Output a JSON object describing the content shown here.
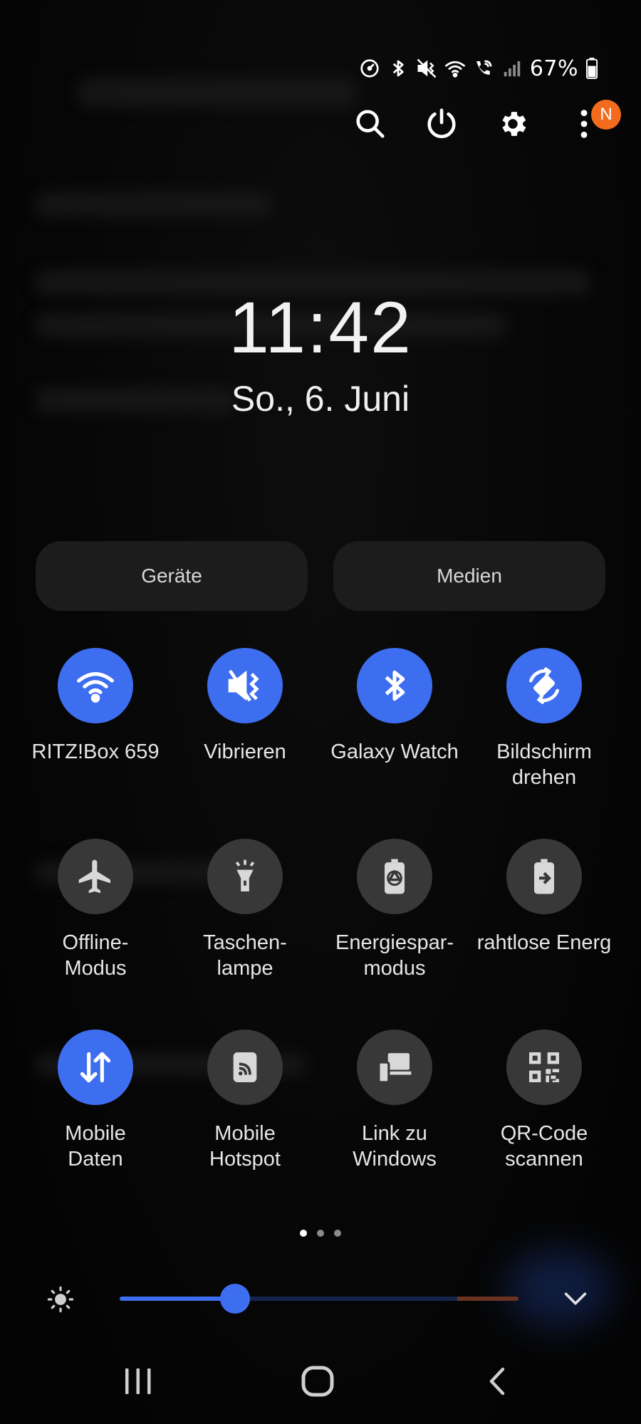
{
  "status_bar": {
    "battery_percent": "67%",
    "icons": [
      "speedometer-icon",
      "bluetooth-icon",
      "vibrate-icon",
      "wifi-icon",
      "wifi-call-icon",
      "signal-icon",
      "battery-icon"
    ]
  },
  "top_actions": {
    "badge": "N",
    "icons": [
      "search-icon",
      "power-icon",
      "gear-icon",
      "more-vertical-icon"
    ]
  },
  "clock": {
    "time": "11:42",
    "date": "So., 6. Juni"
  },
  "buttons": {
    "devices": "Geräte",
    "media": "Medien"
  },
  "tiles": [
    {
      "label": "RITZ!Box 659",
      "icon": "wifi-icon",
      "active": true
    },
    {
      "label": "Vibrieren",
      "icon": "vibrate-icon",
      "active": true
    },
    {
      "label": "Galaxy Watch",
      "icon": "bluetooth-icon",
      "active": true
    },
    {
      "label": "Bildschirm\ndrehen",
      "icon": "auto-rotate-icon",
      "active": true
    },
    {
      "label": "Offline-\nModus",
      "icon": "airplane-icon",
      "active": false
    },
    {
      "label": "Taschen-\nlampe",
      "icon": "flashlight-icon",
      "active": false
    },
    {
      "label": "Energiespar-\nmodus",
      "icon": "power-saving-icon",
      "active": false
    },
    {
      "label": "rahtlose Energ",
      "icon": "wireless-powershare-icon",
      "active": false
    },
    {
      "label": "Mobile\nDaten",
      "icon": "mobile-data-icon",
      "active": true
    },
    {
      "label": "Mobile\nHotspot",
      "icon": "hotspot-icon",
      "active": false
    },
    {
      "label": "Link zu\nWindows",
      "icon": "link-to-windows-icon",
      "active": false
    },
    {
      "label": "QR-Code\nscannen",
      "icon": "qr-code-icon",
      "active": false
    }
  ],
  "pager": {
    "pages": 3,
    "current": 1
  },
  "brightness": {
    "level": 0.29
  },
  "colors": {
    "accent": "#3e6ef0",
    "tile_off": "#383838",
    "badge": "#f36c1e",
    "pill": "#1c1c1c"
  }
}
